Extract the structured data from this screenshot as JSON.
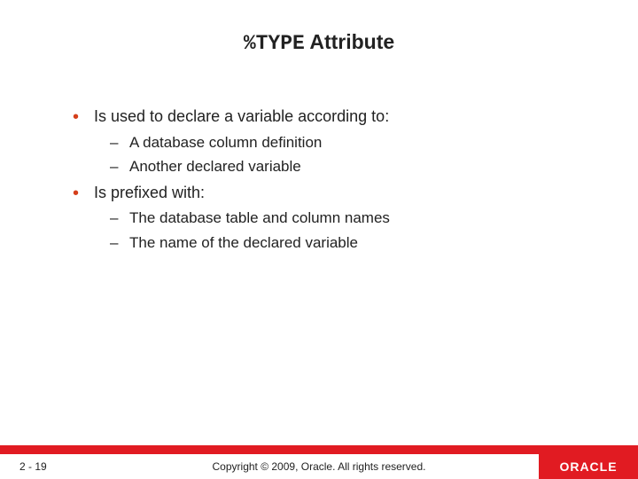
{
  "title": {
    "mono": "%TYPE",
    "rest": " Attribute"
  },
  "bullets": [
    {
      "text": "Is used to declare a variable according to:",
      "sub": [
        "A database column definition",
        "Another declared variable"
      ]
    },
    {
      "text": "Is prefixed with:",
      "sub": [
        "The database table and column names",
        "The name of the declared variable"
      ]
    }
  ],
  "footer": {
    "page": "2 - 19",
    "copyright": "Copyright © 2009, Oracle. All rights reserved.",
    "logo": "ORACLE"
  }
}
